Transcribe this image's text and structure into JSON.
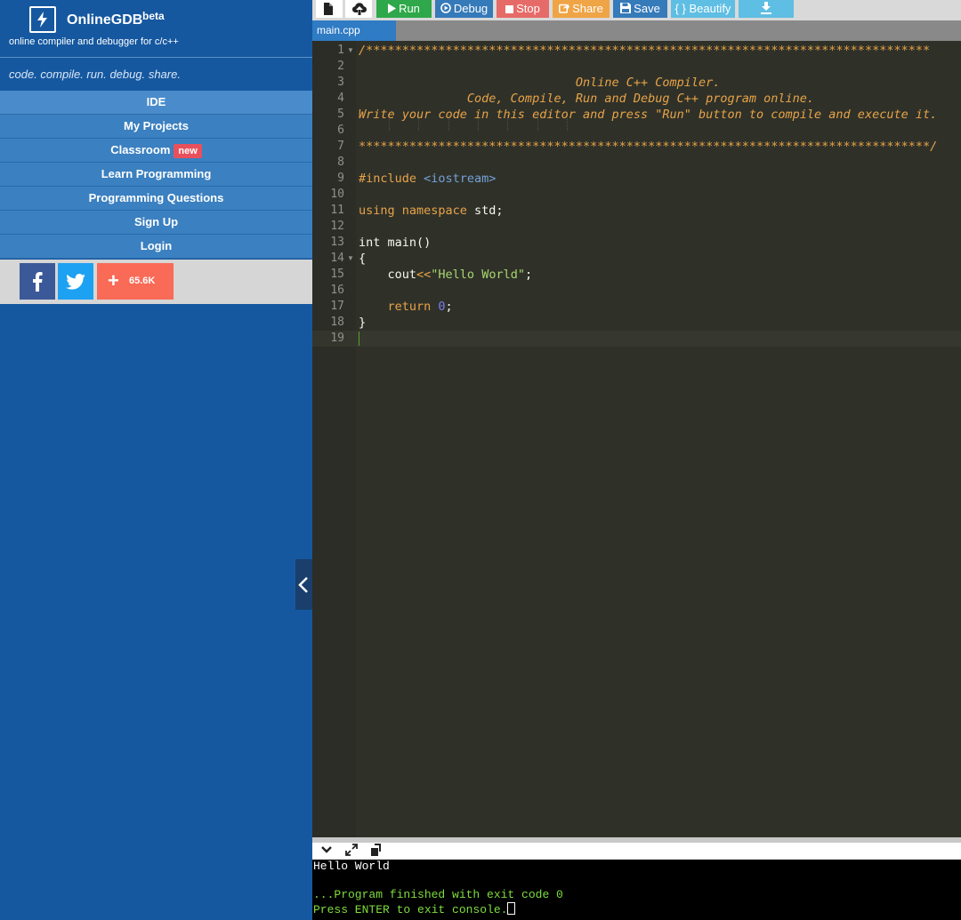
{
  "brand": {
    "name": "OnlineGDB",
    "beta": "beta",
    "subtitle": "online compiler and debugger for c/c++",
    "tagline": "code. compile. run. debug. share."
  },
  "nav": {
    "items": [
      {
        "label": "IDE"
      },
      {
        "label": "My Projects"
      },
      {
        "label": "Classroom",
        "badge": "new"
      },
      {
        "label": "Learn Programming"
      },
      {
        "label": "Programming Questions"
      },
      {
        "label": "Sign Up"
      },
      {
        "label": "Login"
      }
    ]
  },
  "social": {
    "share_count": "65.6K",
    "icons": [
      "facebook-icon",
      "twitter-icon",
      "plus-icon"
    ]
  },
  "toolbar": {
    "run": "Run",
    "debug": "Debug",
    "stop": "Stop",
    "share": "Share",
    "save": "Save",
    "beautify": "{ } Beautify"
  },
  "tabs": {
    "file": "main.cpp"
  },
  "editor": {
    "line_numbers": [
      "1",
      "2",
      "3",
      "4",
      "5",
      "6",
      "7",
      "8",
      "9",
      "10",
      "11",
      "12",
      "13",
      "14",
      "15",
      "16",
      "17",
      "18",
      "19"
    ],
    "lines": {
      "l1": "/******************************************************************************",
      "l3": "                              Online C++ Compiler.",
      "l4": "               Code, Compile, Run and Debug C++ program online.",
      "l5": "Write your code in this editor and press \"Run\" button to compile and execute it.",
      "l7": "*******************************************************************************/",
      "l9_pre": "#include ",
      "l9_inc": "<iostream>",
      "l11_kw": "using namespace",
      "l11_rest": " std;",
      "l13": "int main()",
      "l14": "{",
      "l15_a": "    cout",
      "l15_op": "<<",
      "l15_str": "\"Hello World\"",
      "l15_end": ";",
      "l17_kw": "    return ",
      "l17_num": "0",
      "l17_end": ";",
      "l18": "}"
    }
  },
  "console": {
    "output": "Hello World",
    "finished": "...Program finished with exit code 0",
    "press": "Press ENTER to exit console."
  },
  "colors": {
    "sidebar": "#1558a0",
    "nav_item": "#3b80c0",
    "run": "#2ea84a",
    "debug": "#357ab9",
    "stop": "#e66b68",
    "share": "#efa445",
    "beautify": "#5fbee3",
    "editor_bg": "#2f3129",
    "comment": "#e8a348",
    "console_green": "#7edd3c"
  }
}
